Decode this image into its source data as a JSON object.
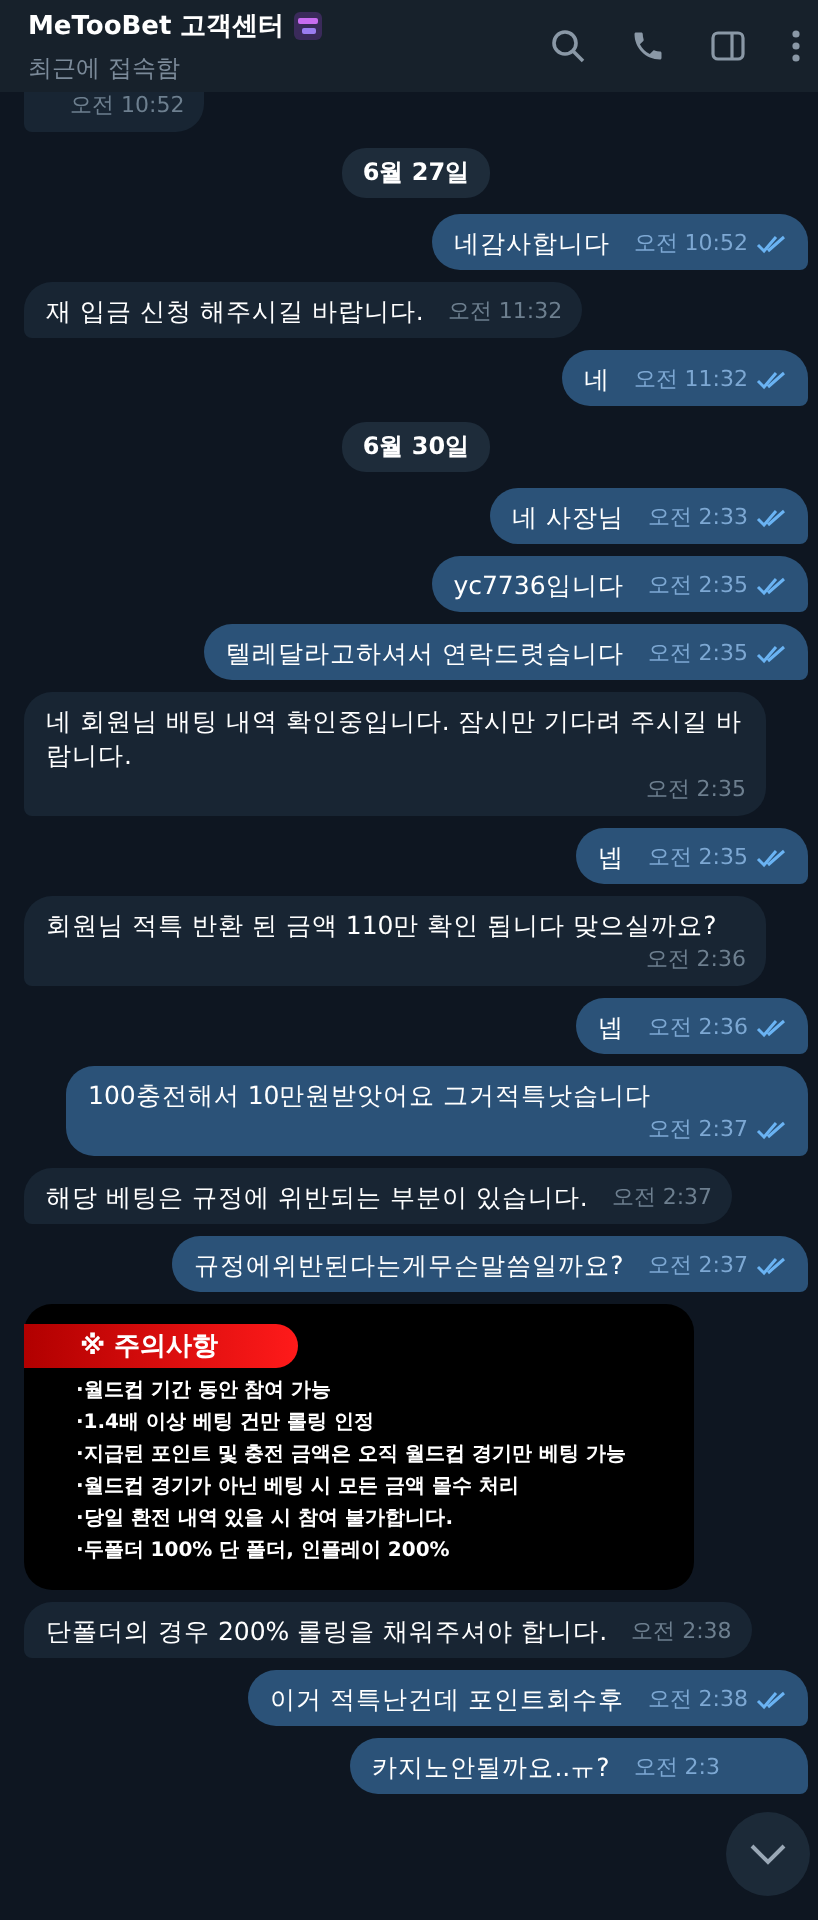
{
  "header": {
    "title": "MeTooBet 고객센터",
    "status": "최근에 접속함"
  },
  "messages": [
    {
      "kind": "in",
      "time": "오전 10:52"
    },
    {
      "kind": "date",
      "text": "6월 27일"
    },
    {
      "kind": "out",
      "text": "네감사합니다",
      "time": "오전 10:52",
      "read": true
    },
    {
      "kind": "in",
      "text": "재 입금 신청 해주시길 바랍니다.",
      "time": "오전 11:32"
    },
    {
      "kind": "out",
      "text": "네",
      "time": "오전 11:32",
      "read": true
    },
    {
      "kind": "date",
      "text": "6월 30일"
    },
    {
      "kind": "out",
      "text": "네 사장님",
      "time": "오전 2:33",
      "read": true
    },
    {
      "kind": "out",
      "text": "yc7736입니다",
      "time": "오전 2:35",
      "read": true
    },
    {
      "kind": "out",
      "text": "텔레달라고하셔서 연락드렷습니다",
      "time": "오전 2:35",
      "read": true
    },
    {
      "kind": "in",
      "text": "네 회원님 배팅 내역 확인중입니다. 잠시만 기다려 주시길 바랍니다.",
      "time": "오전 2:35"
    },
    {
      "kind": "out",
      "text": "넵",
      "time": "오전 2:35",
      "read": true
    },
    {
      "kind": "in",
      "text": "회원님 적특 반환 된 금액 110만 확인 됩니다 맞으실까요?",
      "time": "오전 2:36"
    },
    {
      "kind": "out",
      "text": "넵",
      "time": "오전 2:36",
      "read": true
    },
    {
      "kind": "out",
      "text": "100충전해서 10만원받앗어요 그거적특낫습니다",
      "time": "오전 2:37",
      "read": true
    },
    {
      "kind": "in",
      "text": "해당 베팅은 규정에 위반되는 부분이 있습니다.",
      "time": "오전 2:37"
    },
    {
      "kind": "out",
      "text": "규정에위반된다는게무슨말씀일까요?",
      "time": "오전 2:37",
      "read": true
    },
    {
      "kind": "image",
      "heading": "※ 주의사항",
      "lines": [
        "·월드컵 기간 동안 참여 가능",
        "·1.4배 이상 베팅 건만 롤링 인정",
        "·지급된 포인트 및 충전 금액은 오직 월드컵 경기만 베팅 가능",
        "·월드컵 경기가 아닌 베팅 시 모든 금액 몰수 처리",
        "·당일 환전 내역 있을 시 참여 불가합니다.",
        "·두폴더 100% 단 폴더, 인플레이 200%"
      ]
    },
    {
      "kind": "in",
      "text": "단폴더의 경우 200% 롤링을 채워주셔야 합니다.",
      "time": "오전 2:38"
    },
    {
      "kind": "out",
      "text": "이거 적특난건데 포인트회수후",
      "time": "오전 2:38",
      "read": true
    },
    {
      "kind": "out",
      "text": "카지노안될까요..ㅠ?",
      "time": "오전 2:3"
    }
  ]
}
